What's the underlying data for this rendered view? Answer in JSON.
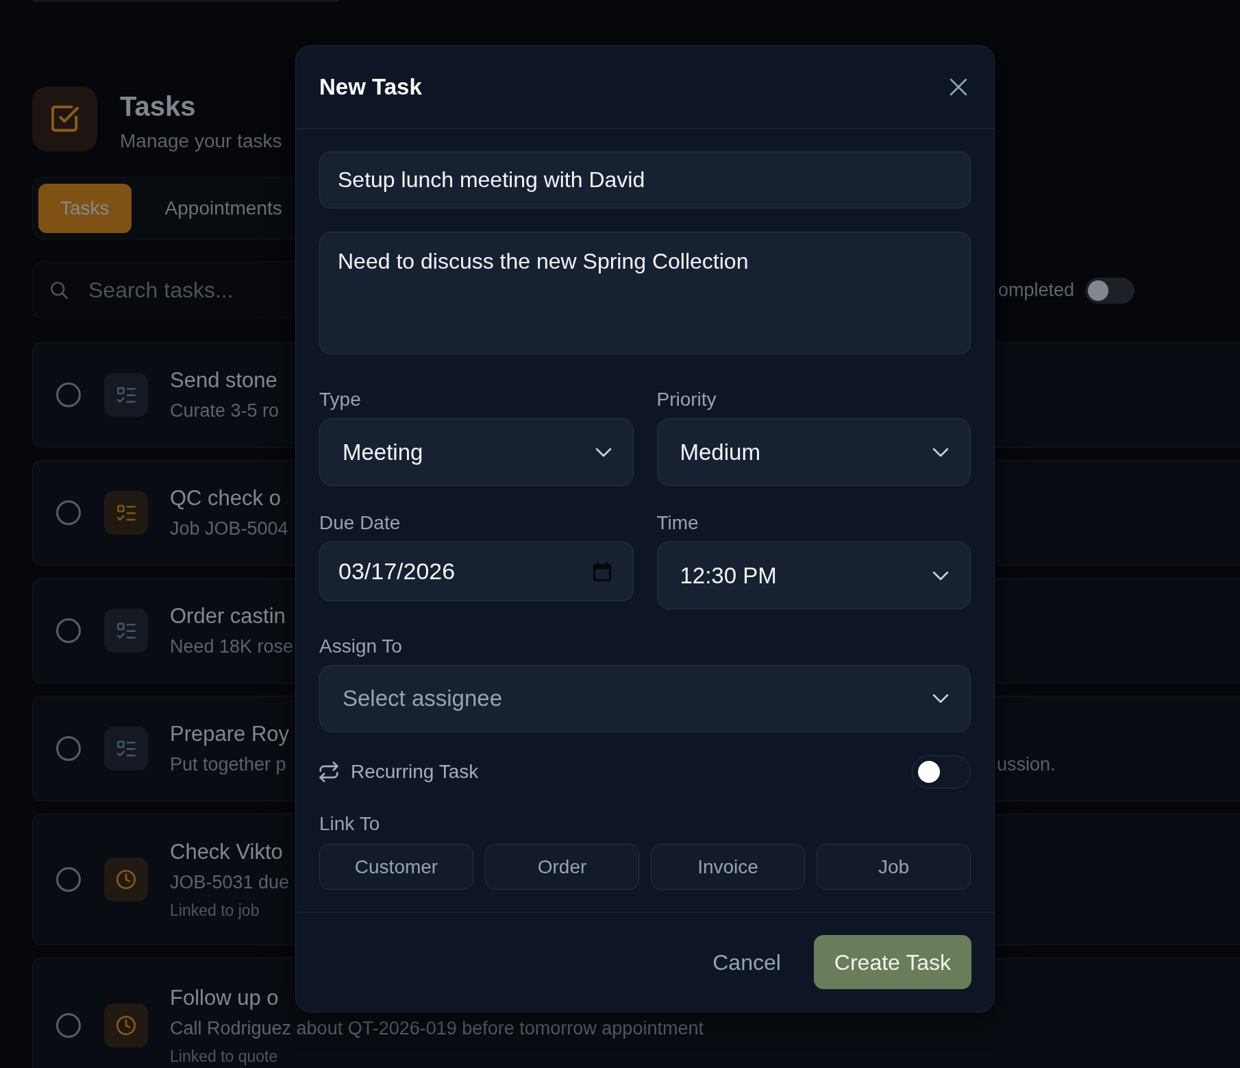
{
  "page": {
    "header": {
      "title": "Tasks",
      "subtitle": "Manage your tasks"
    },
    "tabs": [
      {
        "label": "Tasks",
        "selected": true
      },
      {
        "label": "Appointments",
        "selected": false
      }
    ],
    "search": {
      "placeholder": "Search tasks..."
    },
    "show_completed": {
      "label": "ompleted",
      "on": false
    },
    "tasks": [
      {
        "title": "Send stone",
        "subtitle": "Curate 3-5 ro",
        "kind": "checklist",
        "color": "#44536a",
        "completed": false
      },
      {
        "title": "QC check o",
        "subtitle": "Job JOB-5004",
        "kind": "checklist",
        "color": "#7d5415",
        "completed": false
      },
      {
        "title": "Order castin",
        "subtitle": "Need 18K rose",
        "kind": "checklist",
        "color": "#44536a",
        "completed": false
      },
      {
        "title": "Prepare Roy",
        "subtitle": "Put together p",
        "subtitle_tail": "ussion.",
        "kind": "checklist",
        "color": "#44536a",
        "completed": false
      },
      {
        "title": "Check Vikto",
        "subtitle": "JOB-5031 due",
        "note": "Linked to job",
        "kind": "clock",
        "color": "#8a5a14",
        "completed": false
      },
      {
        "title": "Follow up o",
        "subtitle": "Call Rodriguez about QT-2026-019 before tomorrow appointment",
        "note": "Linked to quote",
        "kind": "clock",
        "color": "#8a5a14",
        "completed": false
      }
    ]
  },
  "dialog": {
    "title": "New Task",
    "title_input": {
      "value": "Setup lunch meeting with David"
    },
    "description": {
      "value": "Need to discuss the new Spring Collection"
    },
    "fields": [
      {
        "label": "Type",
        "kind": "select",
        "value": "Meeting"
      },
      {
        "label": "Priority",
        "kind": "select",
        "value": "Medium"
      },
      {
        "label": "Due Date",
        "kind": "date",
        "value": "03/17/2026"
      },
      {
        "label": "Time",
        "kind": "select",
        "value": "12:30 PM"
      }
    ],
    "assign_to": {
      "label": "Assign To",
      "placeholder": "Select assignee"
    },
    "recurring": {
      "label": "Recurring Task",
      "on": false
    },
    "link_to": {
      "label": "Link To",
      "options": [
        {
          "label": "Customer",
          "selected": false
        },
        {
          "label": "Order",
          "selected": false
        },
        {
          "label": "Invoice",
          "selected": false
        },
        {
          "label": "Job",
          "selected": false
        }
      ]
    },
    "actions": [
      {
        "label": "Cancel",
        "kind": "secondary"
      },
      {
        "label": "Create Task",
        "kind": "primary"
      }
    ]
  }
}
